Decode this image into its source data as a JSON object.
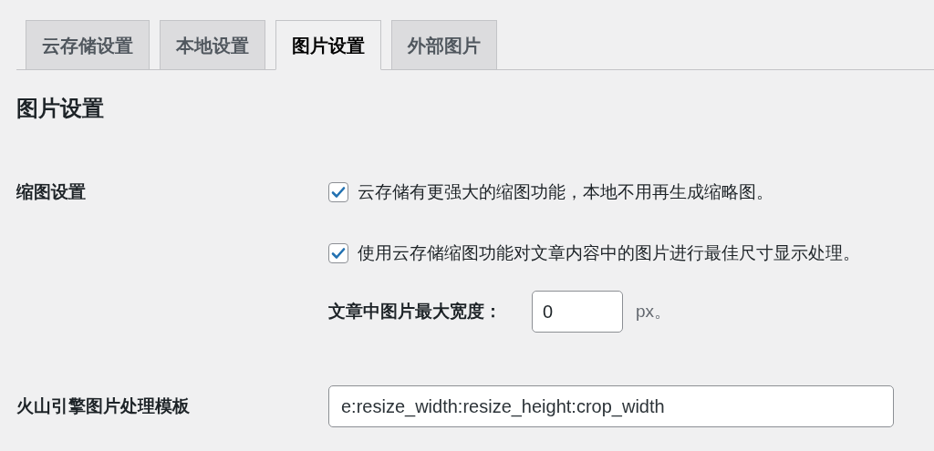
{
  "tabs": [
    {
      "label": "云存储设置",
      "selected": false
    },
    {
      "label": "本地设置",
      "selected": false
    },
    {
      "label": "图片设置",
      "selected": true
    },
    {
      "label": "外部图片",
      "selected": false
    }
  ],
  "heading": "图片设置",
  "thumbnail_settings": {
    "label": "缩图设置",
    "options": [
      {
        "label": "云存储有更强大的缩图功能，本地不用再生成缩略图。",
        "checked": true
      },
      {
        "label": "使用云存储缩图功能对文章内容中的图片进行最佳尺寸显示处理。",
        "checked": true
      }
    ],
    "max_width": {
      "label": "文章中图片最大宽度：",
      "value": "0",
      "unit": "px。"
    }
  },
  "template": {
    "label": "火山引擎图片处理模板",
    "value": "e:resize_width:resize_height:crop_width"
  }
}
